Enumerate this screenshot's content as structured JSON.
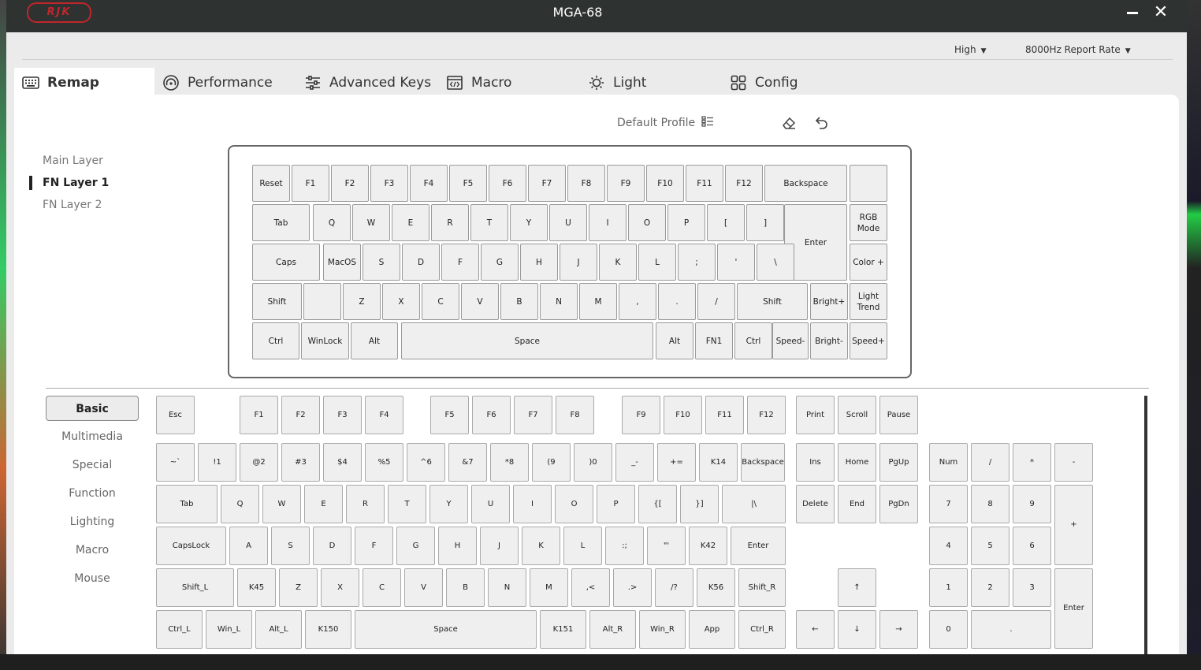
{
  "app": {
    "logo": "RJK",
    "title": "MGA-68"
  },
  "toolbar": {
    "polling": "High",
    "report_rate": "8000Hz Report Rate"
  },
  "tabs": [
    {
      "label": "Remap",
      "icon": "keyboard-icon",
      "active": true
    },
    {
      "label": "Performance",
      "icon": "gauge-icon"
    },
    {
      "label": "Advanced Keys",
      "icon": "sliders-icon"
    },
    {
      "label": "Macro",
      "icon": "code-icon"
    },
    {
      "label": "Light",
      "icon": "sun-icon"
    },
    {
      "label": "Config",
      "icon": "grid-icon"
    }
  ],
  "profile": {
    "label": "Default Profile"
  },
  "layers": [
    {
      "label": "Main Layer"
    },
    {
      "label": "FN Layer 1",
      "active": true
    },
    {
      "label": "FN Layer 2"
    }
  ],
  "upper_keys": {
    "row1": [
      "Reset",
      "F1",
      "F2",
      "F3",
      "F4",
      "F5",
      "F6",
      "F7",
      "F8",
      "F9",
      "F10",
      "F11",
      "F12",
      "Backspace",
      ""
    ],
    "row2": [
      "Tab",
      "Q",
      "W",
      "E",
      "R",
      "T",
      "Y",
      "U",
      "I",
      "O",
      "P",
      "[",
      "]",
      "Enter",
      "RGB Mode"
    ],
    "row3": [
      "Caps",
      "MacOS",
      "S",
      "D",
      "F",
      "G",
      "H",
      "J",
      "K",
      "L",
      ";",
      "'",
      "\\",
      "Color +"
    ],
    "row4": [
      "Shift",
      "",
      "Z",
      "X",
      "C",
      "V",
      "B",
      "N",
      "M",
      ",",
      ".",
      "/",
      "Shift",
      "Bright+",
      "Light Trend"
    ],
    "row5": [
      "Ctrl",
      "WinLock",
      "Alt",
      "Space",
      "Alt",
      "FN1",
      "Ctrl",
      "Speed-",
      "Bright-",
      "Speed+"
    ]
  },
  "categories": [
    {
      "label": "Basic",
      "active": true
    },
    {
      "label": "Multimedia"
    },
    {
      "label": "Special"
    },
    {
      "label": "Function"
    },
    {
      "label": "Lighting"
    },
    {
      "label": "Macro"
    },
    {
      "label": "Mouse"
    }
  ],
  "lower_keys": {
    "row1": [
      "Esc",
      "F1",
      "F2",
      "F3",
      "F4",
      "F5",
      "F6",
      "F7",
      "F8",
      "F9",
      "F10",
      "F11",
      "F12",
      "Print",
      "Scroll",
      "Pause"
    ],
    "row2": [
      "~`",
      "!1",
      "@2",
      "#3",
      "$4",
      "%5",
      "^6",
      "&7",
      "*8",
      "(9",
      ")0",
      "_-",
      "+=",
      "K14",
      "Backspace",
      "Ins",
      "Home",
      "PgUp",
      "Num",
      "/",
      "*",
      "-"
    ],
    "row3": [
      "Tab",
      "Q",
      "W",
      "E",
      "R",
      "T",
      "Y",
      "U",
      "I",
      "O",
      "P",
      "{[",
      "}]",
      "|\\",
      "Delete",
      "End",
      "PgDn",
      "7",
      "8",
      "9",
      "+"
    ],
    "row4": [
      "CapsLock",
      "A",
      "S",
      "D",
      "F",
      "G",
      "H",
      "J",
      "K",
      "L",
      ":;",
      "\"'",
      "K42",
      "Enter",
      "4",
      "5",
      "6"
    ],
    "row5": [
      "Shift_L",
      "K45",
      "Z",
      "X",
      "C",
      "V",
      "B",
      "N",
      "M",
      ",<",
      ".>",
      "/?",
      "K56",
      "Shift_R",
      "↑",
      "1",
      "2",
      "3",
      "Enter"
    ],
    "row6": [
      "Ctrl_L",
      "Win_L",
      "Alt_L",
      "K150",
      "Space",
      "K151",
      "Alt_R",
      "Win_R",
      "App",
      "Ctrl_R",
      "←",
      "↓",
      "→",
      "0",
      "."
    ]
  }
}
